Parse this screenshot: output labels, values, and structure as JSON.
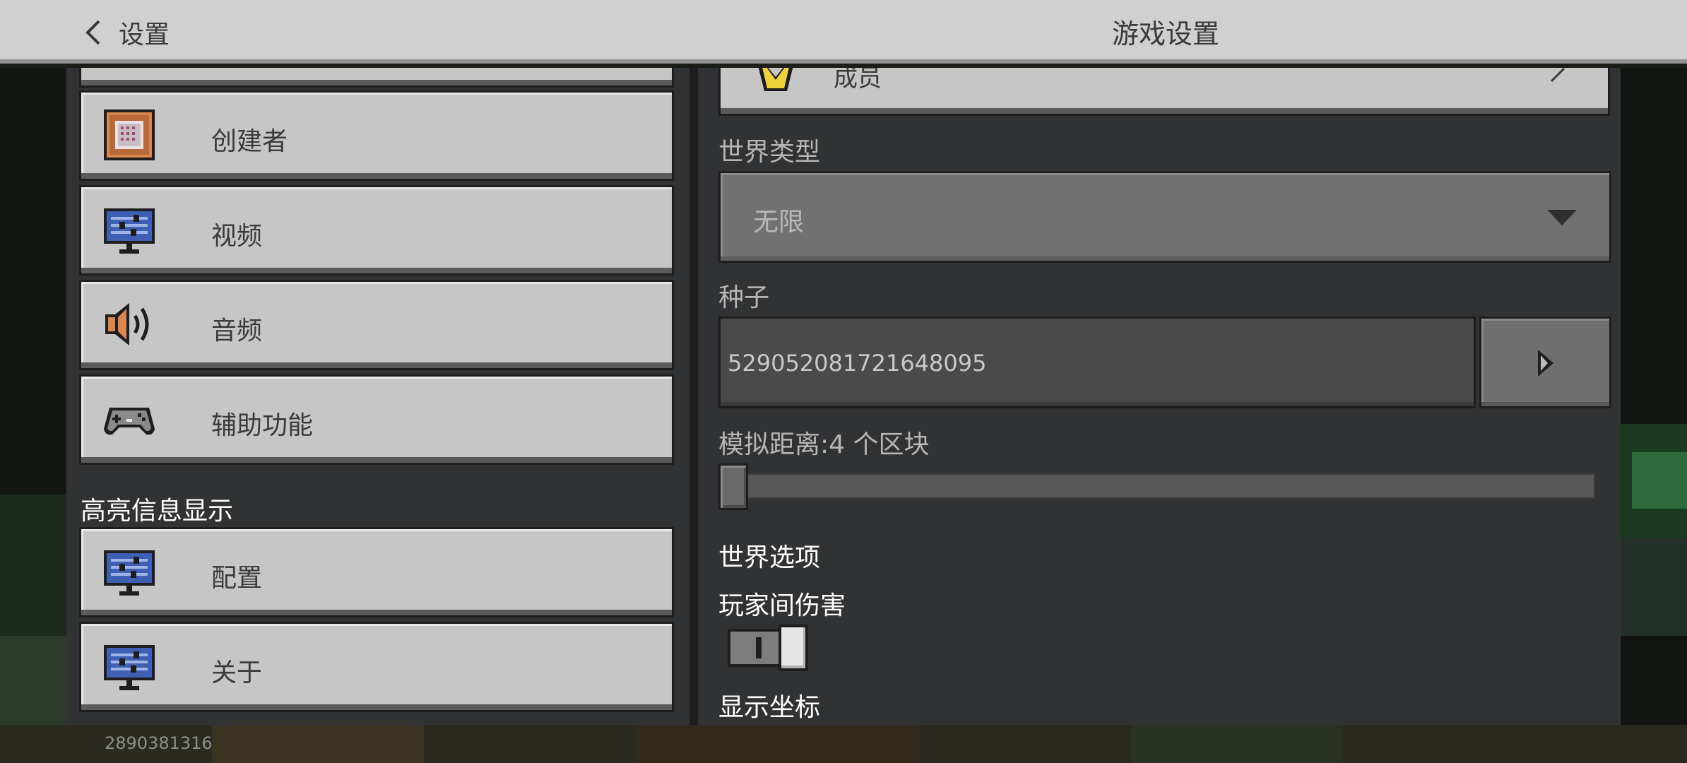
{
  "header": {
    "back_label": "设置",
    "title": "游戏设置"
  },
  "left_menu": {
    "items": [
      {
        "label": "创建者",
        "icon": "command-block-icon"
      },
      {
        "label": "视频",
        "icon": "monitor-icon"
      },
      {
        "label": "音频",
        "icon": "speaker-icon"
      },
      {
        "label": "辅助功能",
        "icon": "gamepad-icon"
      }
    ],
    "section_title": "高亮信息显示",
    "section_items": [
      {
        "label": "配置",
        "icon": "monitor-icon"
      },
      {
        "label": "关于",
        "icon": "monitor-icon"
      }
    ]
  },
  "right_panel": {
    "top_partial_label": "成员",
    "world_type_label": "世界类型",
    "world_type_value": "无限",
    "seed_label": "种子",
    "seed_value": "529052081721648095",
    "sim_distance_label": "模拟距离:4 个区块",
    "world_options_title": "世界选项",
    "pvp_label": "玩家间伤害",
    "pvp_enabled": true,
    "show_coords_label": "显示坐标"
  },
  "version": "2890381316"
}
